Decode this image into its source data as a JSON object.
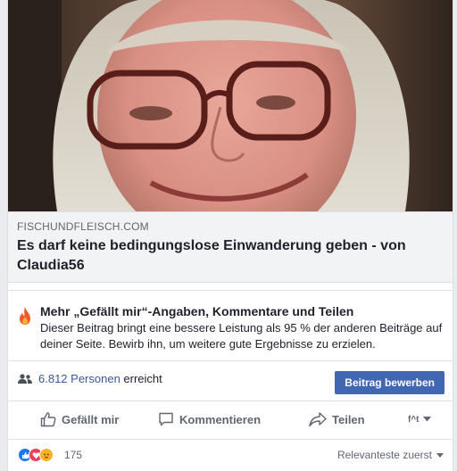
{
  "link_preview": {
    "domain": "FISCHUNDFLEISCH.COM",
    "title": "Es darf keine bedingungslose Einwanderung geben - von Claudia56"
  },
  "tip": {
    "title": "Mehr „Gefällt mir“-Angaben, Kommentare und Teilen",
    "body": "Dieser Beitrag bringt eine bessere Leistung als 95 % der anderen Beiträge auf deiner Seite. Bewirb ihn, um weitere gute Ergebnisse zu erzielen.",
    "icon": "fire-icon"
  },
  "reach": {
    "count": "6.812 Personen",
    "suffix": " erreicht",
    "boost_label": "Beitrag bewerben"
  },
  "actions": {
    "like": "Gefällt mir",
    "comment": "Kommentieren",
    "share": "Teilen",
    "page_mini": "f^t"
  },
  "reactions": {
    "count": "175",
    "icons": [
      "like-reaction-icon",
      "love-reaction-icon",
      "angry-reaction-icon"
    ],
    "sort_label": "Relevanteste zuerst"
  },
  "colors": {
    "accent": "#4267b2",
    "link": "#385898",
    "fire": "#f05a28"
  }
}
